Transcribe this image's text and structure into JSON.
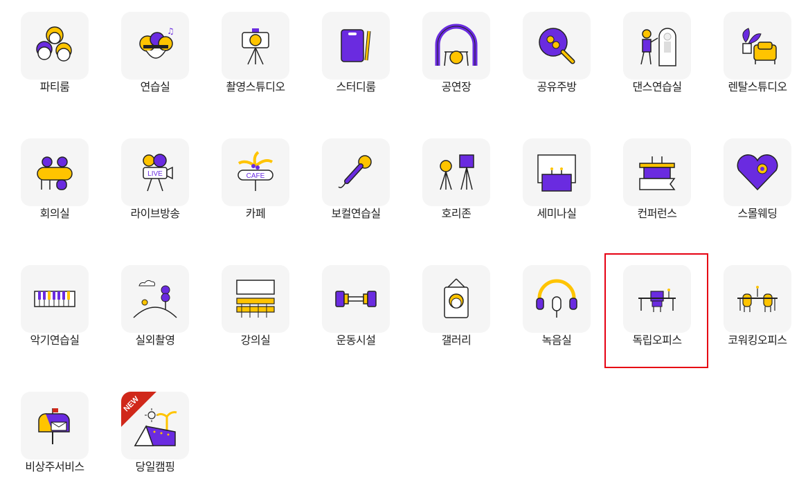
{
  "accent": {
    "purple": "#6a2be0",
    "yellow": "#ffc400",
    "outline": "#222222",
    "highlight": "#e60012",
    "badge": "#d0281a"
  },
  "categories": [
    {
      "label": "파티룸",
      "icon": "party-people-icon"
    },
    {
      "label": "연습실",
      "icon": "practice-singers-icon"
    },
    {
      "label": "촬영스튜디오",
      "icon": "camera-tripod-icon"
    },
    {
      "label": "스터디룸",
      "icon": "notebook-pen-icon"
    },
    {
      "label": "공연장",
      "icon": "stage-drum-icon"
    },
    {
      "label": "공유주방",
      "icon": "frying-pan-icon"
    },
    {
      "label": "댄스연습실",
      "icon": "dancer-mirror-icon"
    },
    {
      "label": "렌탈스튜디오",
      "icon": "plant-sofa-icon"
    },
    {
      "label": "회의실",
      "icon": "meeting-table-icon"
    },
    {
      "label": "라이브방송",
      "icon": "live-camera-icon"
    },
    {
      "label": "카페",
      "icon": "cafe-sign-icon"
    },
    {
      "label": "보컬연습실",
      "icon": "microphone-icon"
    },
    {
      "label": "호리존",
      "icon": "studio-lights-icon"
    },
    {
      "label": "세미나실",
      "icon": "seminar-podium-icon"
    },
    {
      "label": "컨퍼런스",
      "icon": "conference-desk-icon"
    },
    {
      "label": "스몰웨딩",
      "icon": "heart-flower-icon"
    },
    {
      "label": "악기연습실",
      "icon": "piano-keys-icon"
    },
    {
      "label": "실외촬영",
      "icon": "outdoor-hill-icon"
    },
    {
      "label": "강의실",
      "icon": "lecture-room-icon"
    },
    {
      "label": "운동시설",
      "icon": "dumbbell-icon"
    },
    {
      "label": "갤러리",
      "icon": "framed-portrait-icon"
    },
    {
      "label": "녹음실",
      "icon": "headphones-mic-icon"
    },
    {
      "label": "독립오피스",
      "icon": "office-desk-icon"
    },
    {
      "label": "코워킹오피스",
      "icon": "coworking-table-icon"
    },
    {
      "label": "비상주서비스",
      "icon": "mailbox-icon"
    },
    {
      "label": "당일캠핑",
      "icon": "camping-tent-icon",
      "badge": "NEW"
    }
  ]
}
